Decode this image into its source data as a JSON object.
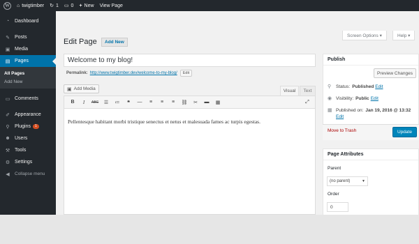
{
  "admin_bar": {
    "site_name": "twigtimber",
    "updates_count": "1",
    "comments_count": "0",
    "new_label": "New",
    "view_page_label": "View Page"
  },
  "sidebar": {
    "items": [
      {
        "label": "Dashboard",
        "icon": "dashboard-icon"
      },
      {
        "label": "Posts",
        "icon": "pin-icon"
      },
      {
        "label": "Media",
        "icon": "media-icon"
      },
      {
        "label": "Pages",
        "icon": "pages-icon"
      },
      {
        "label": "Comments",
        "icon": "comments-icon"
      },
      {
        "label": "Appearance",
        "icon": "brush-icon"
      },
      {
        "label": "Plugins",
        "icon": "plugin-icon",
        "badge": "1"
      },
      {
        "label": "Users",
        "icon": "users-icon"
      },
      {
        "label": "Tools",
        "icon": "wrench-icon"
      },
      {
        "label": "Settings",
        "icon": "settings-icon"
      }
    ],
    "pages_submenu": [
      "All Pages",
      "Add New"
    ],
    "collapse_label": "Collapse menu",
    "active_color": "#0073aa"
  },
  "screen_meta": {
    "screen_options": "Screen Options ▾",
    "help": "Help ▾"
  },
  "header": {
    "title": "Edit Page",
    "add_new": "Add New"
  },
  "post": {
    "title": "Welcome to my blog!",
    "permalink_label": "Permalink:",
    "permalink_url": "http://www.twigtimber.dev/welcome-to-my-blog/",
    "permalink_edit": "Edit",
    "content": "Pellentesque habitant morbi tristique senectus et netus et malesuada fames ac turpis egestas."
  },
  "editor": {
    "add_media": "Add Media",
    "tab_visual": "Visual",
    "tab_text": "Text"
  },
  "publish_box": {
    "title": "Publish",
    "preview": "Preview Changes",
    "status_label": "Status:",
    "status_value": "Published",
    "visibility_label": "Visibility:",
    "visibility_value": "Public",
    "published_label": "Published on:",
    "published_value": "Jan 19, 2016 @ 13:32",
    "edit": "Edit",
    "trash": "Move to Trash",
    "update": "Update",
    "update_color": "#0085ba"
  },
  "page_attributes": {
    "title": "Page Attributes",
    "parent_label": "Parent",
    "parent_value": "(no parent)",
    "order_label": "Order",
    "order_value": "0"
  }
}
